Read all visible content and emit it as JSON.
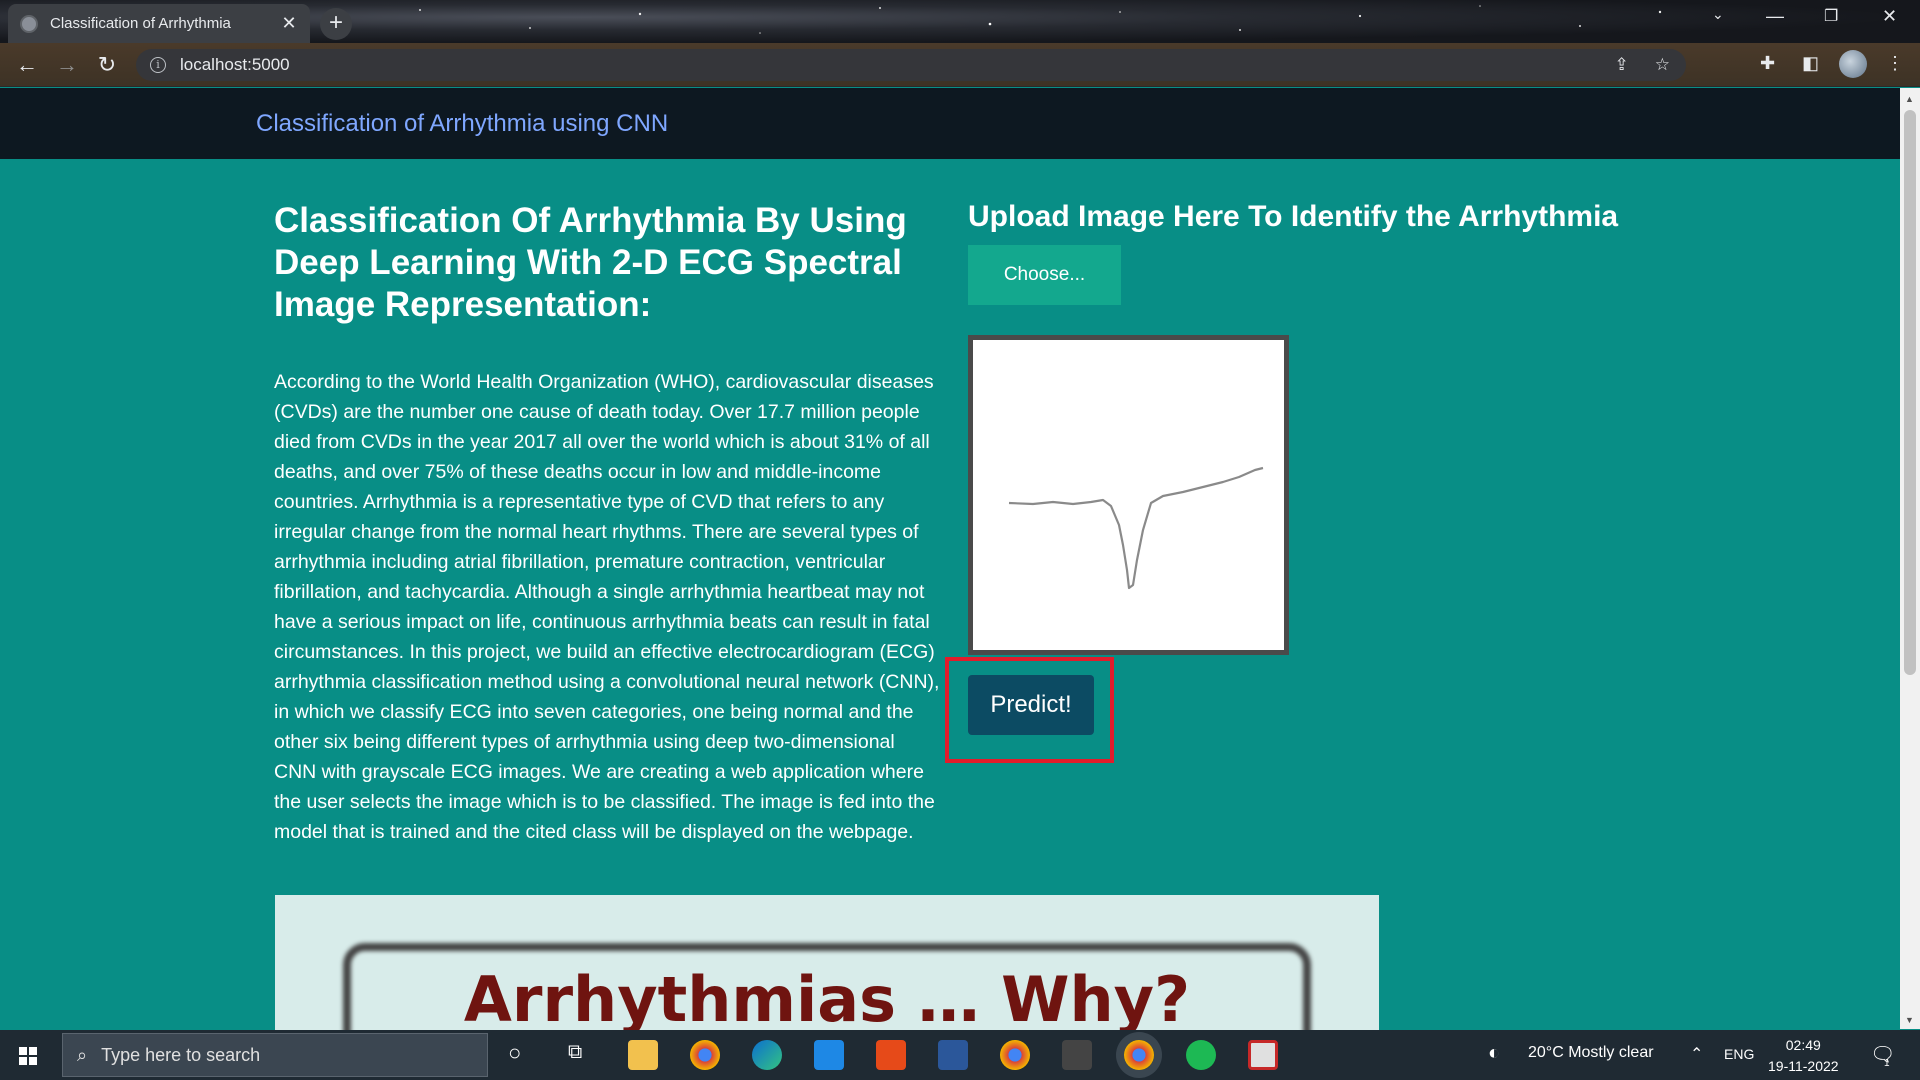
{
  "browser": {
    "tab_title": "Classification of Arrhythmia",
    "url": "localhost:5000"
  },
  "navbar": {
    "brand": "Classification of Arrhythmia using CNN"
  },
  "main": {
    "heading": "Classification Of Arrhythmia By Using Deep Learning With 2-D ECG Spectral Image Representation:",
    "paragraph": "According to the World Health Organization (WHO), cardiovascular diseases (CVDs) are the number one cause of death today. Over 17.7 million people died from CVDs in the year 2017 all over the world which is about 31% of all deaths, and over 75% of these deaths occur in low and middle-income countries. Arrhythmia is a representative type of CVD that refers to any irregular change from the normal heart rhythms. There are several types of arrhythmia including atrial fibrillation, premature contraction, ventricular fibrillation, and tachycardia. Although a single arrhythmia heartbeat may not have a serious impact on life, continuous arrhythmia beats can result in fatal circumstances. In this project, we build an effective electrocardiogram (ECG) arrhythmia classification method using a convolutional neural network (CNN), in which we classify ECG into seven categories, one being normal and the other six being different types of arrhythmia using deep two-dimensional CNN with grayscale ECG images. We are creating a web application where the user selects the image which is to be classified. The image is fed into the model that is trained and the cited class will be displayed on the webpage."
  },
  "upload": {
    "title": "Upload Image Here To Identify the Arrhythmia",
    "choose_label": "Choose...",
    "predict_label": "Predict!"
  },
  "banner": {
    "text": "Arrhythmias … Why?"
  },
  "taskbar": {
    "search_placeholder": "Type here to search",
    "weather": "20°C  Mostly clear",
    "language": "ENG",
    "time": "02:49",
    "date": "19-11-2022",
    "notification_count": "1"
  },
  "colors": {
    "page_bg": "#088e86",
    "navbar_bg": "#0d1821",
    "brand": "#7fa7ff",
    "choose_button": "#13a88e",
    "predict_button": "#0c4b63",
    "highlight_outline": "#e21c2b"
  }
}
